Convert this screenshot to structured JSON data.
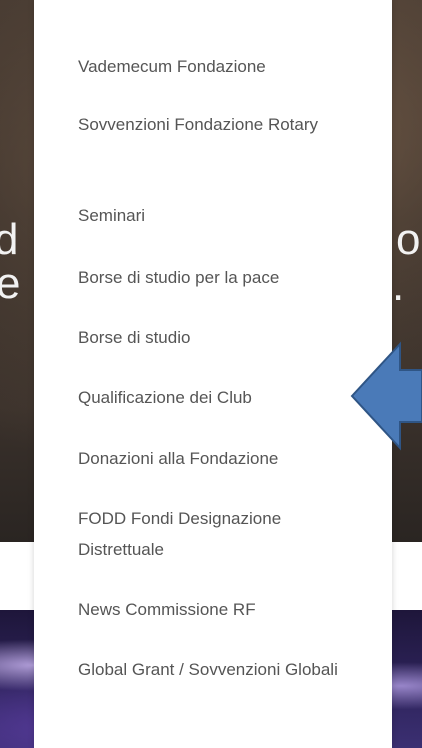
{
  "hero": {
    "fragment_left_line1": "d",
    "fragment_left_line2": "e i",
    "fragment_right_line1": "o;",
    "fragment_right_line2": "."
  },
  "menu": {
    "items": [
      {
        "label": "Vademecum Fondazione"
      },
      {
        "label": "Sovvenzioni Fondazione Rotary"
      },
      {
        "label": "Seminari"
      },
      {
        "label": "Borse di studio per la pace"
      },
      {
        "label": "Borse di studio"
      },
      {
        "label": "Qualificazione dei Club"
      },
      {
        "label": "Donazioni alla Fondazione"
      },
      {
        "label": "FODD Fondi Designazione Distrettuale"
      },
      {
        "label": "News Commissione RF"
      },
      {
        "label": "Global Grant / Sovvenzioni Globali"
      }
    ]
  },
  "annotation": {
    "icon": "left-arrow-icon",
    "fill_color": "#4a7ab8",
    "stroke_color": "#2f5585"
  }
}
